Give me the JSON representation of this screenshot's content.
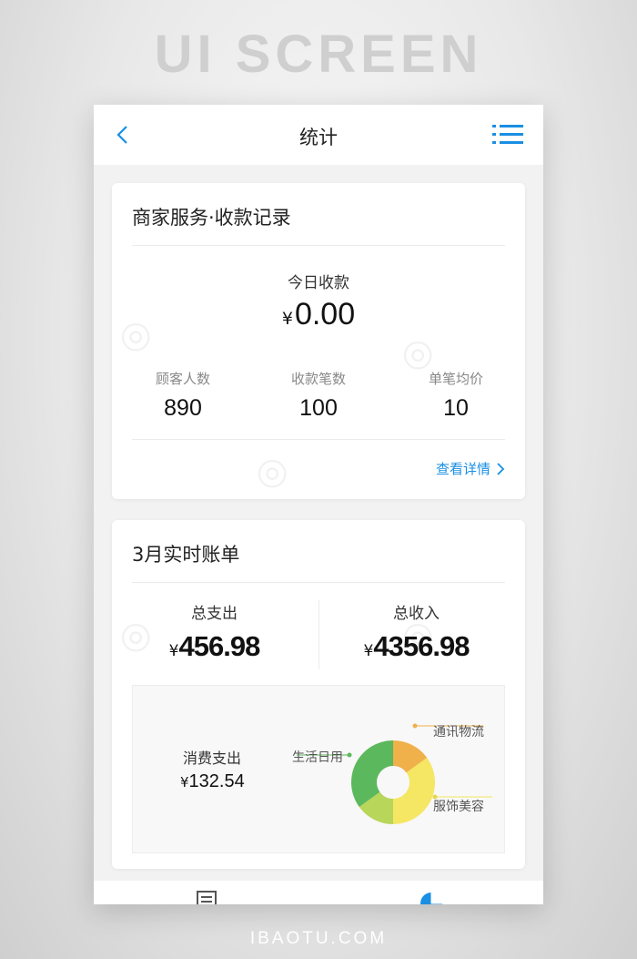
{
  "banner": "UI SCREEN",
  "footer": "IBAOTU.COM",
  "navbar": {
    "title": "统计",
    "back_icon": "chevron-left-icon",
    "menu_icon": "list-menu-icon",
    "accent": "#1a8fe3"
  },
  "merchant_card": {
    "title": "商家服务·收款记录",
    "today_label": "今日收款",
    "currency": "¥",
    "today_amount": "0.00",
    "stats": [
      {
        "label": "顾客人数",
        "value": "890"
      },
      {
        "label": "收款笔数",
        "value": "100"
      },
      {
        "label": "单笔均价",
        "value": "10"
      }
    ],
    "detail_link": "查看详情"
  },
  "bill_card": {
    "title": "3月实时账单",
    "currency": "¥",
    "total_expense_label": "总支出",
    "total_expense": "456.98",
    "total_income_label": "总收入",
    "total_income": "4356.98",
    "spend_label": "消费支出",
    "spend_amount": "132.54"
  },
  "chart_data": {
    "type": "pie",
    "style": "donut",
    "labels": [
      "通讯物流",
      "服饰美容",
      "生活日用"
    ],
    "values": [
      15,
      35,
      50
    ],
    "colors": [
      "#f0b04a",
      "#f5e664",
      "#5cb85c"
    ],
    "extra_segment": {
      "color": "#b8d65a",
      "value": 15
    },
    "label_text": {
      "tongxun": "通讯物流",
      "fushi": "服饰美容",
      "shenghuo": "生活日用"
    }
  },
  "tabbar": {
    "icons": [
      "document-icon",
      "pie-chart-icon"
    ]
  }
}
